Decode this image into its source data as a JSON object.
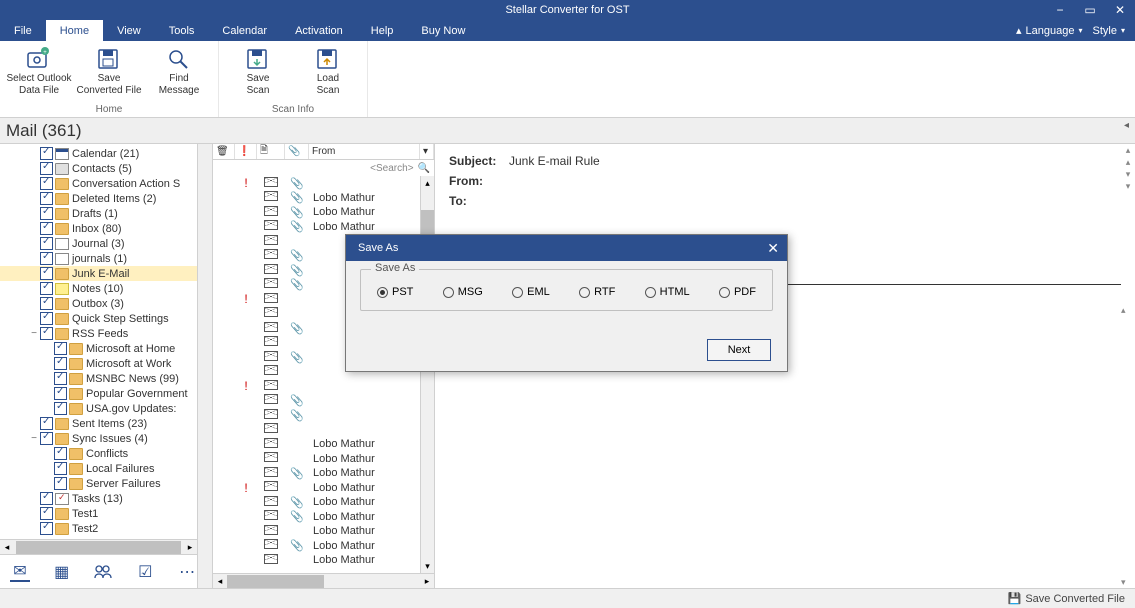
{
  "app": {
    "title": "Stellar Converter for OST"
  },
  "menu": {
    "items": [
      "File",
      "Home",
      "View",
      "Tools",
      "Calendar",
      "Activation",
      "Help",
      "Buy Now"
    ],
    "active": 1,
    "language_label": "Language",
    "style_label": "Style"
  },
  "ribbon": {
    "groups": [
      {
        "label": "Home",
        "buttons": [
          {
            "label": "Select Outlook\nData File",
            "name": "select-outlook-data-file"
          },
          {
            "label": "Save\nConverted File",
            "name": "save-converted-file"
          },
          {
            "label": "Find\nMessage",
            "name": "find-message"
          }
        ]
      },
      {
        "label": "Scan Info",
        "buttons": [
          {
            "label": "Save\nScan",
            "name": "save-scan"
          },
          {
            "label": "Load\nScan",
            "name": "load-scan"
          }
        ]
      }
    ]
  },
  "mail_header": "Mail (361)",
  "tree": [
    {
      "indent": 2,
      "icon": "cal",
      "label": "Calendar (21)"
    },
    {
      "indent": 2,
      "icon": "con",
      "label": "Contacts (5)"
    },
    {
      "indent": 2,
      "icon": "folder",
      "label": "Conversation Action S"
    },
    {
      "indent": 2,
      "icon": "folder",
      "label": "Deleted Items (2)"
    },
    {
      "indent": 2,
      "icon": "folder",
      "label": "Drafts (1)"
    },
    {
      "indent": 2,
      "icon": "folder",
      "label": "Inbox (80)"
    },
    {
      "indent": 2,
      "icon": "journal",
      "label": "Journal (3)"
    },
    {
      "indent": 2,
      "icon": "journal",
      "label": "journals (1)"
    },
    {
      "indent": 2,
      "icon": "folder",
      "label": "Junk E-Mail",
      "sel": true
    },
    {
      "indent": 2,
      "icon": "note",
      "label": "Notes (10)"
    },
    {
      "indent": 2,
      "icon": "folder",
      "label": "Outbox (3)"
    },
    {
      "indent": 2,
      "icon": "folder",
      "label": "Quick Step Settings"
    },
    {
      "indent": 2,
      "icon": "folder",
      "label": "RSS Feeds",
      "exp": "−"
    },
    {
      "indent": 3,
      "icon": "folder",
      "label": "Microsoft at Home"
    },
    {
      "indent": 3,
      "icon": "folder",
      "label": "Microsoft at Work"
    },
    {
      "indent": 3,
      "icon": "folder",
      "label": "MSNBC News (99)"
    },
    {
      "indent": 3,
      "icon": "folder",
      "label": "Popular Government"
    },
    {
      "indent": 3,
      "icon": "folder",
      "label": "USA.gov Updates:"
    },
    {
      "indent": 2,
      "icon": "folder",
      "label": "Sent Items (23)"
    },
    {
      "indent": 2,
      "icon": "folder",
      "label": "Sync Issues (4)",
      "exp": "−"
    },
    {
      "indent": 3,
      "icon": "folder",
      "label": "Conflicts"
    },
    {
      "indent": 3,
      "icon": "folder",
      "label": "Local Failures"
    },
    {
      "indent": 3,
      "icon": "folder",
      "label": "Server Failures"
    },
    {
      "indent": 2,
      "icon": "task",
      "label": "Tasks (13)"
    },
    {
      "indent": 2,
      "icon": "folder",
      "label": "Test1"
    },
    {
      "indent": 2,
      "icon": "folder",
      "label": "Test2"
    }
  ],
  "msglist": {
    "columns": {
      "from": "From"
    },
    "search_placeholder": "<Search>",
    "rows": [
      {
        "imp": "!",
        "att": true,
        "from": ""
      },
      {
        "att": true,
        "from": "Lobo Mathur"
      },
      {
        "att": true,
        "from": "Lobo Mathur"
      },
      {
        "att": true,
        "from": "Lobo Mathur"
      },
      {
        "from": ""
      },
      {
        "att": true,
        "from": ""
      },
      {
        "att": true,
        "from": ""
      },
      {
        "att": true,
        "from": ""
      },
      {
        "imp": "!",
        "from": ""
      },
      {
        "from": ""
      },
      {
        "att": true,
        "from": ""
      },
      {
        "from": ""
      },
      {
        "att": true,
        "from": ""
      },
      {
        "from": ""
      },
      {
        "imp": "!",
        "from": ""
      },
      {
        "att": true,
        "from": ""
      },
      {
        "att": true,
        "from": ""
      },
      {
        "from": ""
      },
      {
        "from": "Lobo Mathur"
      },
      {
        "from": "Lobo Mathur"
      },
      {
        "att": true,
        "from": "Lobo Mathur"
      },
      {
        "imp": "!",
        "from": "Lobo Mathur"
      },
      {
        "att": true,
        "from": "Lobo Mathur"
      },
      {
        "att": true,
        "from": "Lobo Mathur"
      },
      {
        "from": "Lobo Mathur"
      },
      {
        "att": true,
        "from": "Lobo Mathur"
      },
      {
        "from": "Lobo Mathur"
      }
    ]
  },
  "preview": {
    "subject_label": "Subject:",
    "subject_value": "Junk E-mail Rule",
    "from_label": "From:",
    "from_value": "",
    "to_label": "To:",
    "to_value": ""
  },
  "dialog": {
    "title": "Save As",
    "legend": "Save As",
    "options": [
      "PST",
      "MSG",
      "EML",
      "RTF",
      "HTML",
      "PDF"
    ],
    "selected": 0,
    "next_label": "Next"
  },
  "status": {
    "save_label": "Save Converted File"
  }
}
